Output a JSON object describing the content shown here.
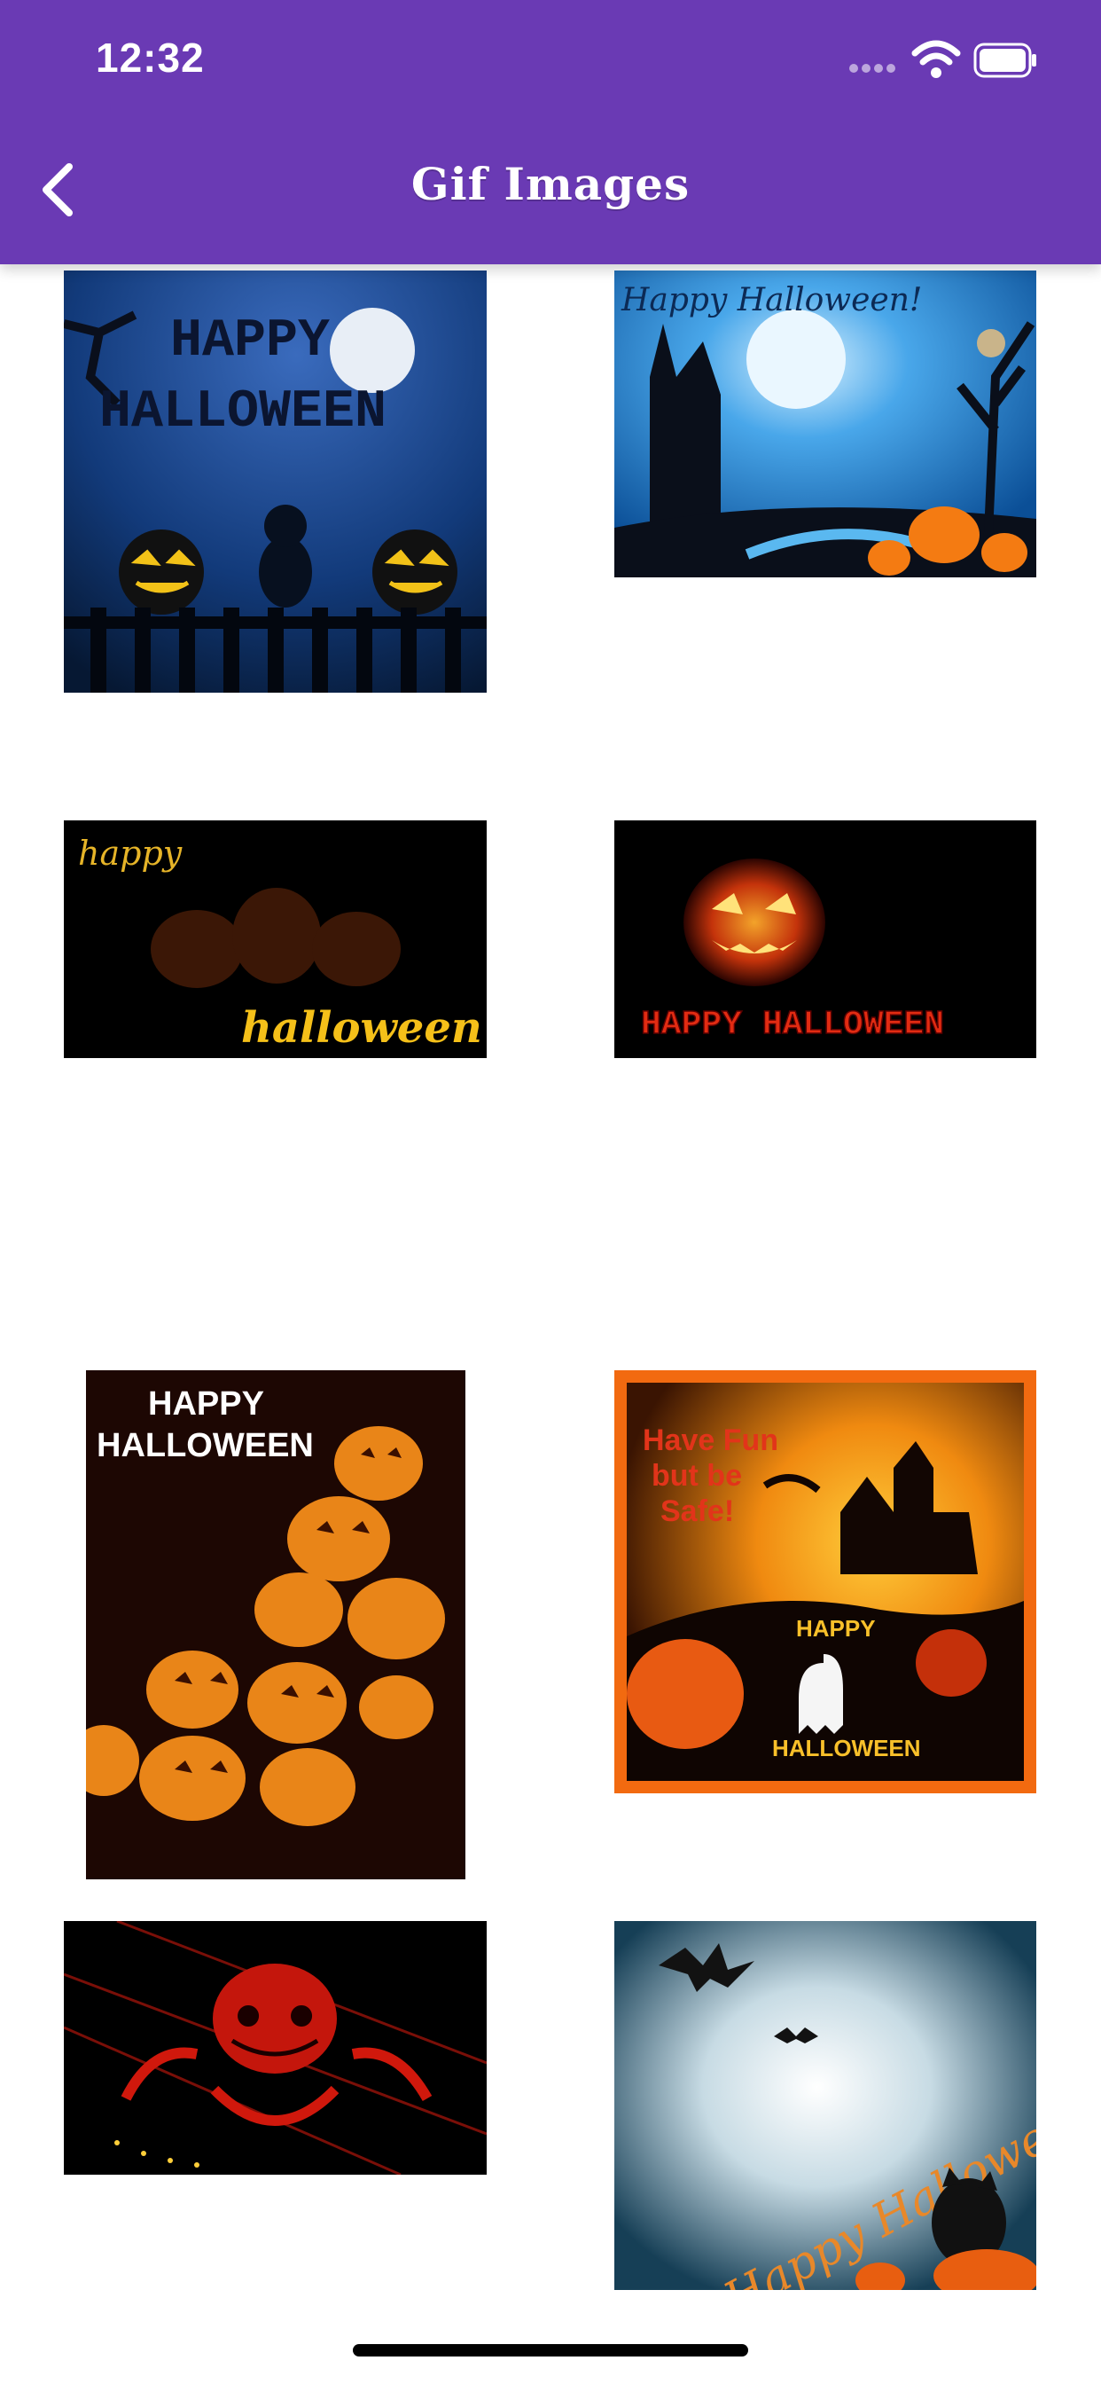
{
  "status_bar": {
    "time": "12:32"
  },
  "nav": {
    "title": "Gif Images",
    "back_icon": "chevron-left-icon"
  },
  "colors": {
    "header": "#6a3ab4",
    "background": "#ffffff"
  },
  "gifs": [
    {
      "caption_line1": "HAPPY",
      "caption_line2": "HALLOWEEN"
    },
    {
      "caption": "Happy Halloween!"
    },
    {
      "caption_top": "happy",
      "caption_bottom": "halloween"
    },
    {
      "caption": "HAPPY HALLOWEEN"
    },
    {
      "caption_line1": "HAPPY",
      "caption_line2": "HALLOWEEN"
    },
    {
      "line1": "Have Fun",
      "line2": "but be",
      "line3": "Safe!",
      "badge1": "HAPPY",
      "badge2": "HALLOWEEN"
    },
    {},
    {
      "caption": "Happy Halloween!!"
    }
  ]
}
